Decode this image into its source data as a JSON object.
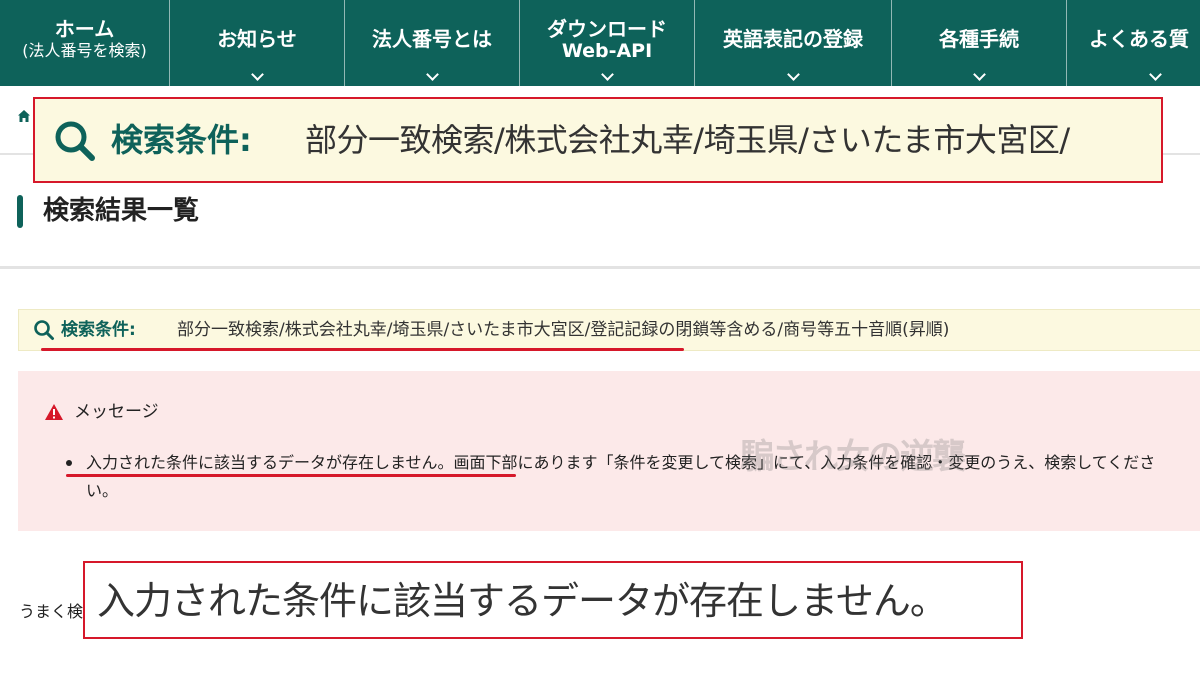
{
  "nav": {
    "items": [
      {
        "label": "ホーム",
        "sub": "(法人番号を検索)"
      },
      {
        "label": "お知らせ",
        "sub": ""
      },
      {
        "label": "法人番号とは",
        "sub": ""
      },
      {
        "label": "ダウンロード",
        "sub": "Web-API"
      },
      {
        "label": "英語表記の登録",
        "sub": ""
      },
      {
        "label": "各種手続",
        "sub": ""
      },
      {
        "label": "よくある質",
        "sub": ""
      }
    ]
  },
  "zoom_top": {
    "label": "検索条件:",
    "value": "部分一致検索/株式会社丸幸/埼玉県/さいたま市大宮区/"
  },
  "page_title": "検索結果一覧",
  "search_condition": {
    "label": "検索条件:",
    "value": "部分一致検索/株式会社丸幸/埼玉県/さいたま市大宮区/登記記録の閉鎖等含める/商号等五十音順(昇順)"
  },
  "message": {
    "title": "メッセージ",
    "emphasis": "入力された条件に該当するデータが存在しません。",
    "body": "画面下部にあります「条件を変更して検索」にて、入力条件を確認・変更のうえ、検索してください。"
  },
  "watermark": "騙され女の逆襲",
  "partial_text": "うまく検",
  "zoom_bottom": {
    "text": "入力された条件に該当するデータが存在しません。"
  },
  "colors": {
    "nav_bg": "#0e625a",
    "accent_red": "#d6182a",
    "condition_bg": "#fcf9e0",
    "message_bg": "#fce9e9"
  }
}
